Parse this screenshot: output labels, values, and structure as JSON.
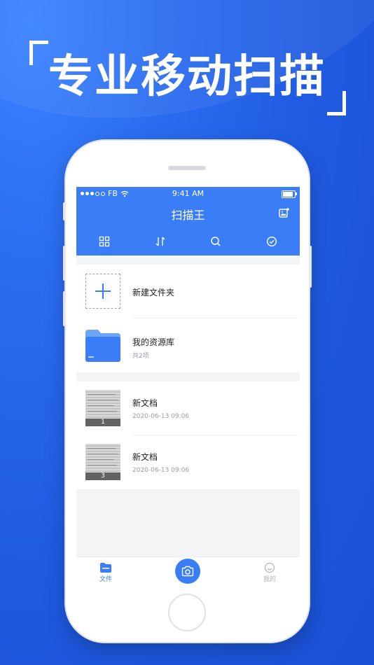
{
  "promo": {
    "headline": "专业移动扫描"
  },
  "status_bar": {
    "carrier": "FB",
    "time": "9:41 AM",
    "battery_level": 0.85
  },
  "header": {
    "title": "扫描王"
  },
  "toolbar": {
    "icons": [
      "grid-icon",
      "sort-icon",
      "search-icon",
      "check-circle-icon"
    ]
  },
  "folders": [
    {
      "title": "新建文件夹",
      "subtitle": "",
      "icon": "plus-icon"
    },
    {
      "title": "我的资源库",
      "subtitle": "共2项",
      "icon": "folder-icon"
    }
  ],
  "documents": [
    {
      "title": "新文档",
      "date": "2020-06-13  09:06",
      "page_count": "1"
    },
    {
      "title": "新文档",
      "date": "2020-06-13  09:06",
      "page_count": "3"
    }
  ],
  "tabbar": {
    "tabs": [
      {
        "label": "文件",
        "icon": "file-icon",
        "active": true
      },
      {
        "label": "我的",
        "icon": "smiley-icon",
        "active": false
      }
    ],
    "camera": "camera-icon"
  },
  "colors": {
    "accent": "#3a7df6",
    "background": "#1f5ae0",
    "muted": "#9a9ca3"
  }
}
